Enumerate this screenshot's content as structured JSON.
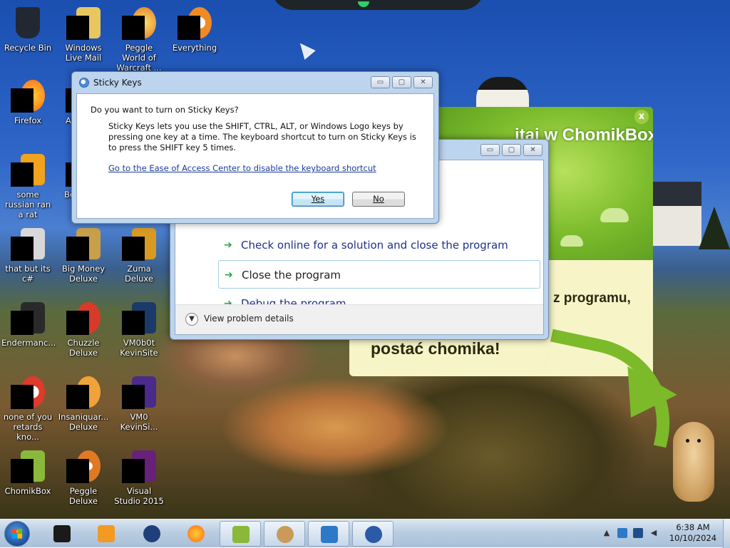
{
  "desktop": {
    "icons": [
      {
        "label": "Recycle Bin",
        "icon": "recycle-bin-icon",
        "color": "#222831"
      },
      {
        "label": "Windows Live Mail",
        "icon": "mail-icon",
        "color": "#e8c660"
      },
      {
        "label": "Peggle World of Warcraft ...",
        "icon": "peggle-icon",
        "color": "#e07a22"
      },
      {
        "label": "Everything",
        "icon": "everything-icon",
        "color": "#f08a24"
      },
      {
        "label": "Firefox",
        "icon": "firefox-icon",
        "color": "#ff7a1a"
      },
      {
        "label": "A",
        "icon": "app-icon",
        "color": "#3a6bb0"
      },
      {
        "label": "some russian ran a rat",
        "icon": "script-icon",
        "color": "#f2a21c"
      },
      {
        "label": "Be",
        "icon": "app-icon",
        "color": "#3a6bb0"
      },
      {
        "label": "that but its c#",
        "icon": "file-icon",
        "color": "#d8d8d8"
      },
      {
        "label": "Big Money Deluxe",
        "icon": "big-money-icon",
        "color": "#c8a04a"
      },
      {
        "label": "Zuma Deluxe",
        "icon": "zuma-icon",
        "color": "#d89a22"
      },
      {
        "label": "Endermanc...",
        "icon": "console-icon",
        "color": "#2a2a2a"
      },
      {
        "label": "Chuzzle Deluxe",
        "icon": "chuzzle-icon",
        "color": "#d83a2a"
      },
      {
        "label": "VM0b0t KevinSite",
        "icon": "vm-icon",
        "color": "#1b3a6a"
      },
      {
        "label": "none of you retards kno...",
        "icon": "chrome-icon",
        "color": "#e03a2a"
      },
      {
        "label": "Insaniquar... Deluxe",
        "icon": "insaniquarium-icon",
        "color": "#f2a23a"
      },
      {
        "label": "VM0 KevinSi...",
        "icon": "vm-icon",
        "color": "#4a2a8a"
      },
      {
        "label": "ChomikBox",
        "icon": "chomikbox-icon",
        "color": "#8ab83a"
      },
      {
        "label": "Peggle Deluxe",
        "icon": "peggle-icon",
        "color": "#e07a22"
      },
      {
        "label": "Visual Studio 2015",
        "icon": "visual-studio-icon",
        "color": "#68217a"
      }
    ]
  },
  "chomikbox": {
    "title": "itaj w ChomikBox",
    "line1": "z programu,",
    "line2": "postać chomika!",
    "close": "x"
  },
  "error_window": {
    "options": [
      "Check online for a solution and close the program",
      "Close the program",
      "Debug the program"
    ],
    "details": "View problem details"
  },
  "sticky_keys": {
    "title": "Sticky Keys",
    "question": "Do you want to turn on Sticky Keys?",
    "description": "Sticky Keys lets you use the SHIFT, CTRL, ALT, or Windows Logo keys by pressing one key at a time. The keyboard shortcut to turn on Sticky Keys is to press the SHIFT key 5 times.",
    "link": "Go to the Ease of Access Center to disable the keyboard shortcut",
    "yes": "Yes",
    "no": "No"
  },
  "caption_buttons": {
    "minimize": "▭",
    "maximize": "▢",
    "close": "✕"
  },
  "taskbar": {
    "items": [
      {
        "icon": "terminal-icon",
        "color": "#1a1a1a",
        "active": false
      },
      {
        "icon": "media-player-icon",
        "color": "#f29a22",
        "active": false
      },
      {
        "icon": "globe-icon",
        "color": "#1f3f7a",
        "active": false
      },
      {
        "icon": "firefox-icon",
        "color": "#ff7a1a",
        "active": false
      },
      {
        "icon": "chomikbox-icon",
        "color": "#8ab83a",
        "active": true
      },
      {
        "icon": "hamster-icon",
        "color": "#c99a5a",
        "active": true
      },
      {
        "icon": "task-icon",
        "color": "#2f78c8",
        "active": true
      },
      {
        "icon": "settings-icon",
        "color": "#2a5aa8",
        "active": true
      }
    ],
    "tray_icons": [
      "chevron-up-icon",
      "network-icon",
      "monitor-icon",
      "volume-icon"
    ],
    "time": "6:38 AM",
    "date": "10/10/2024"
  }
}
